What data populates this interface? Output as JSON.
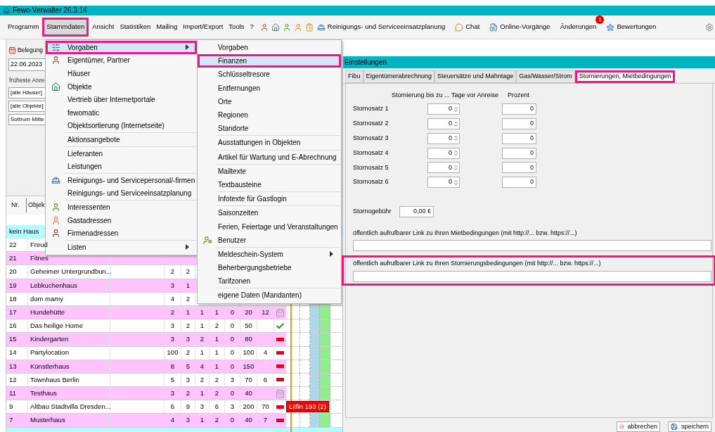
{
  "window": {
    "title": "Fewo-Verwalter 26.3.14"
  },
  "menu_bar": {
    "items": [
      {
        "label": "Programm",
        "selected": false
      },
      {
        "label": "Stammdaten",
        "selected": true,
        "highlighted": true
      },
      {
        "label": "Ansicht",
        "selected": false
      },
      {
        "label": "Statistiken",
        "selected": false
      },
      {
        "label": "Mailing",
        "selected": false
      },
      {
        "label": "Import/Export",
        "selected": false
      },
      {
        "label": "Tools",
        "selected": false
      },
      {
        "label": "?",
        "selected": false
      }
    ],
    "tools": [
      {
        "label": "Reinigungs- und Serviceeinsatzplanung"
      },
      {
        "label": "Chat"
      },
      {
        "label": "Online-Vorgänge"
      },
      {
        "label": "Änderungen",
        "badge": "1"
      },
      {
        "label": "Bewertungen"
      }
    ]
  },
  "left_panel": {
    "tab": "Belegung",
    "date": "22.06.2023",
    "earliest_label": "früheste Anre",
    "filters": [
      "[alle Häuser]",
      "[alle Objekte]",
      "Sottrum Mitte"
    ],
    "table": {
      "columns": [
        "Nr.",
        "Objek"
      ],
      "group": "kein Haus",
      "rows": [
        {
          "nr": "22",
          "name": "Freud",
          "values": [],
          "color": "#ffffff"
        },
        {
          "nr": "21",
          "name": "Fitnes",
          "values": [],
          "color": "#ffc4ff"
        },
        {
          "nr": "20",
          "name": "Geheimer Untergrundbun...",
          "values": [
            "2",
            "2"
          ],
          "color": "#ffffff"
        },
        {
          "nr": "19",
          "name": "Lebkuchenhaus",
          "values": [
            "3",
            "1"
          ],
          "color": "#ffc4ff"
        },
        {
          "nr": "18",
          "name": "dom mamy",
          "values": [
            "4",
            "2"
          ],
          "color": "#ffffff"
        },
        {
          "nr": "17",
          "name": "Hundehütte",
          "values": [
            "2",
            "1",
            "1",
            "1",
            "0",
            "20",
            "12"
          ],
          "kind": "calendar",
          "color": "#ffc4ff"
        },
        {
          "nr": "16",
          "name": "Das heilige Home",
          "values": [
            "3",
            "2",
            "1",
            "2",
            "0",
            "50"
          ],
          "kind": "check",
          "color": "#ffffff"
        },
        {
          "nr": "15",
          "name": "Kindergarten",
          "values": [
            "3",
            "3",
            "2",
            "1",
            "0",
            "80"
          ],
          "kind": "minus",
          "color": "#ffc4ff"
        },
        {
          "nr": "14",
          "name": "Partylocation",
          "values": [
            "100",
            "2",
            "1",
            "1",
            "0",
            "100",
            "4"
          ],
          "kind": "minus",
          "color": "#ffffff"
        },
        {
          "nr": "13",
          "name": "Künstlerhaus",
          "values": [
            "8",
            "5",
            "4",
            "1",
            "0",
            "150"
          ],
          "kind": "minus",
          "color": "#ffc4ff"
        },
        {
          "nr": "12",
          "name": "Townhaus Berlin",
          "values": [
            "5",
            "3",
            "2",
            "2",
            "3",
            "70",
            "6"
          ],
          "kind": "minus",
          "color": "#ffffff"
        },
        {
          "nr": "11",
          "name": "Testhaus",
          "values": [
            "3",
            "2",
            "1",
            "2",
            "0",
            "40"
          ],
          "kind": "calendar",
          "color": "#ffc4ff"
        },
        {
          "nr": "9",
          "name": "Altbau Stadtvilla Dresden...",
          "values": [
            "6",
            "9",
            "3",
            "6",
            "3",
            "200",
            "70"
          ],
          "kind": "minus",
          "color": "#ffffff",
          "bookings": [
            "Litfin 193 (2)"
          ]
        },
        {
          "nr": "7",
          "name": "Musterhaus",
          "values": [
            "4",
            "3",
            "1",
            "2",
            "0",
            "40",
            "7"
          ],
          "kind": "minus",
          "color": "#ffc4ff"
        }
      ]
    }
  },
  "stammdaten_menu": {
    "groups": [
      [
        {
          "label": "Vorgaben",
          "kind": "settings",
          "submenu": true,
          "selected": true,
          "highlighted": true
        },
        {
          "label": "Eigentümer, Partner",
          "kind": "owner",
          "submenu": false,
          "selected": false
        },
        {
          "label": "Häuser",
          "kind": "plain",
          "submenu": false,
          "selected": false
        },
        {
          "label": "Objekte",
          "kind": "house",
          "submenu": false,
          "selected": false
        },
        {
          "label": "Vertrieb über Internetportale",
          "kind": "plain",
          "submenu": false,
          "selected": false
        },
        {
          "label": "fewomatic",
          "kind": "plain",
          "submenu": false,
          "selected": false
        },
        {
          "label": "Objektsortierung (Internetseite)",
          "kind": "plain",
          "submenu": false,
          "selected": false
        }
      ],
      [
        {
          "label": "Aktionsangebote",
          "kind": "plain",
          "submenu": false,
          "selected": false
        }
      ],
      [
        {
          "label": "Lieferanten",
          "kind": "plain",
          "submenu": false,
          "selected": false
        },
        {
          "label": "Leistungen",
          "kind": "plain",
          "submenu": false,
          "selected": false
        }
      ],
      [
        {
          "label": "Reinigungs- und Servicepersonal/-firmen",
          "kind": "worker",
          "submenu": false,
          "selected": false
        },
        {
          "label": "Reinigungs- und Serviceeinsatzplanung",
          "kind": "plain",
          "submenu": false,
          "selected": false
        }
      ],
      [
        {
          "label": "Interessenten",
          "kind": "green-person",
          "submenu": false,
          "selected": false
        },
        {
          "label": "Gastadressen",
          "kind": "orange-person",
          "submenu": false,
          "selected": false
        },
        {
          "label": "Firmenadressen",
          "kind": "red-person",
          "submenu": false,
          "selected": false
        }
      ],
      [
        {
          "label": "Listen",
          "kind": "plain",
          "submenu": true,
          "selected": false
        }
      ]
    ]
  },
  "vorgaben_menu": {
    "groups": [
      [
        {
          "label": "Vorgaben",
          "kind": "plain",
          "submenu": false,
          "selected": false
        },
        {
          "label": "Finanzen",
          "kind": "plain",
          "submenu": false,
          "selected": true,
          "highlighted": true
        },
        {
          "label": "Schlüsseltresore",
          "kind": "plain",
          "submenu": false,
          "selected": false
        },
        {
          "label": "Entfernungen",
          "kind": "plain",
          "submenu": false,
          "selected": false
        },
        {
          "label": "Orte",
          "kind": "plain",
          "submenu": false,
          "selected": false
        },
        {
          "label": "Regionen",
          "kind": "plain",
          "submenu": false,
          "selected": false
        },
        {
          "label": "Standorte",
          "kind": "plain",
          "submenu": false,
          "selected": false
        }
      ],
      [
        {
          "label": "Ausstattungen in Objekten",
          "kind": "plain",
          "submenu": false,
          "selected": false
        }
      ],
      [
        {
          "label": "Artikel für Wartung und E-Abrechnung",
          "kind": "plain",
          "submenu": false,
          "selected": false
        }
      ],
      [
        {
          "label": "Mailtexte",
          "kind": "plain",
          "submenu": false,
          "selected": false
        },
        {
          "label": "Textbausteine",
          "kind": "plain",
          "submenu": false,
          "selected": false
        }
      ],
      [
        {
          "label": "Infotexte für Gastlogin",
          "kind": "plain",
          "submenu": false,
          "selected": false
        }
      ],
      [
        {
          "label": "Saisonzeiten",
          "kind": "plain",
          "submenu": false,
          "selected": false
        },
        {
          "label": "Ferien, Feiertage und Veranstaltungen",
          "kind": "plain",
          "submenu": false,
          "selected": false
        },
        {
          "label": "Benutzer",
          "kind": "user-settings",
          "submenu": false,
          "selected": false
        }
      ],
      [
        {
          "label": "Meldeschein-System",
          "kind": "plain",
          "submenu": true,
          "selected": false
        },
        {
          "label": "Beherbergungsbetriebe",
          "kind": "plain",
          "submenu": false,
          "selected": false
        },
        {
          "label": "Tarifzonen",
          "kind": "plain",
          "submenu": false,
          "selected": false
        }
      ],
      [
        {
          "label": "eigene Daten (Mandanten)",
          "kind": "plain",
          "submenu": false,
          "selected": false
        }
      ]
    ]
  },
  "dialog": {
    "title": "Einstellungen",
    "tabs": [
      {
        "label": "Fibu",
        "selected": false
      },
      {
        "label": "Eigentümerabrechnung",
        "selected": false
      },
      {
        "label": "Steuersätze und Mahntage",
        "selected": false
      },
      {
        "label": "Gas/Wasser/Strom",
        "selected": false
      },
      {
        "label": "Stornierungen, Mietbedingungen",
        "selected": true,
        "highlighted": true
      }
    ],
    "days_header": "Stornierung bis zu ... Tage vor Anreise",
    "percent_header": "Prozent",
    "rates": [
      {
        "label": "Stornosatz 1",
        "days": "0",
        "percent": "0"
      },
      {
        "label": "Stornosatz 2",
        "days": "0",
        "percent": "0"
      },
      {
        "label": "Stornosatz 3",
        "days": "0",
        "percent": "0"
      },
      {
        "label": "Stornosatz 4",
        "days": "0",
        "percent": "0"
      },
      {
        "label": "Stornosatz 5",
        "days": "0",
        "percent": "0"
      },
      {
        "label": "Stornosatz 6",
        "days": "0",
        "percent": "0"
      }
    ],
    "fee": {
      "label": "Stornogebühr",
      "value": "0,00 €"
    },
    "links": [
      {
        "label": "öffentlich aufrufbarer Link zu Ihren Mietbedingungen (mit http://... bzw. https://...)",
        "highlighted": false
      },
      {
        "label": "öffentlich aufrufbarer Link zu Ihren Stornierungsbedingungen (mit http://... bzw. https://...)",
        "highlighted": true
      }
    ],
    "buttons": [
      {
        "label": "abbrechen",
        "kind": "cancel"
      },
      {
        "label": "speichern",
        "kind": "save"
      }
    ]
  }
}
